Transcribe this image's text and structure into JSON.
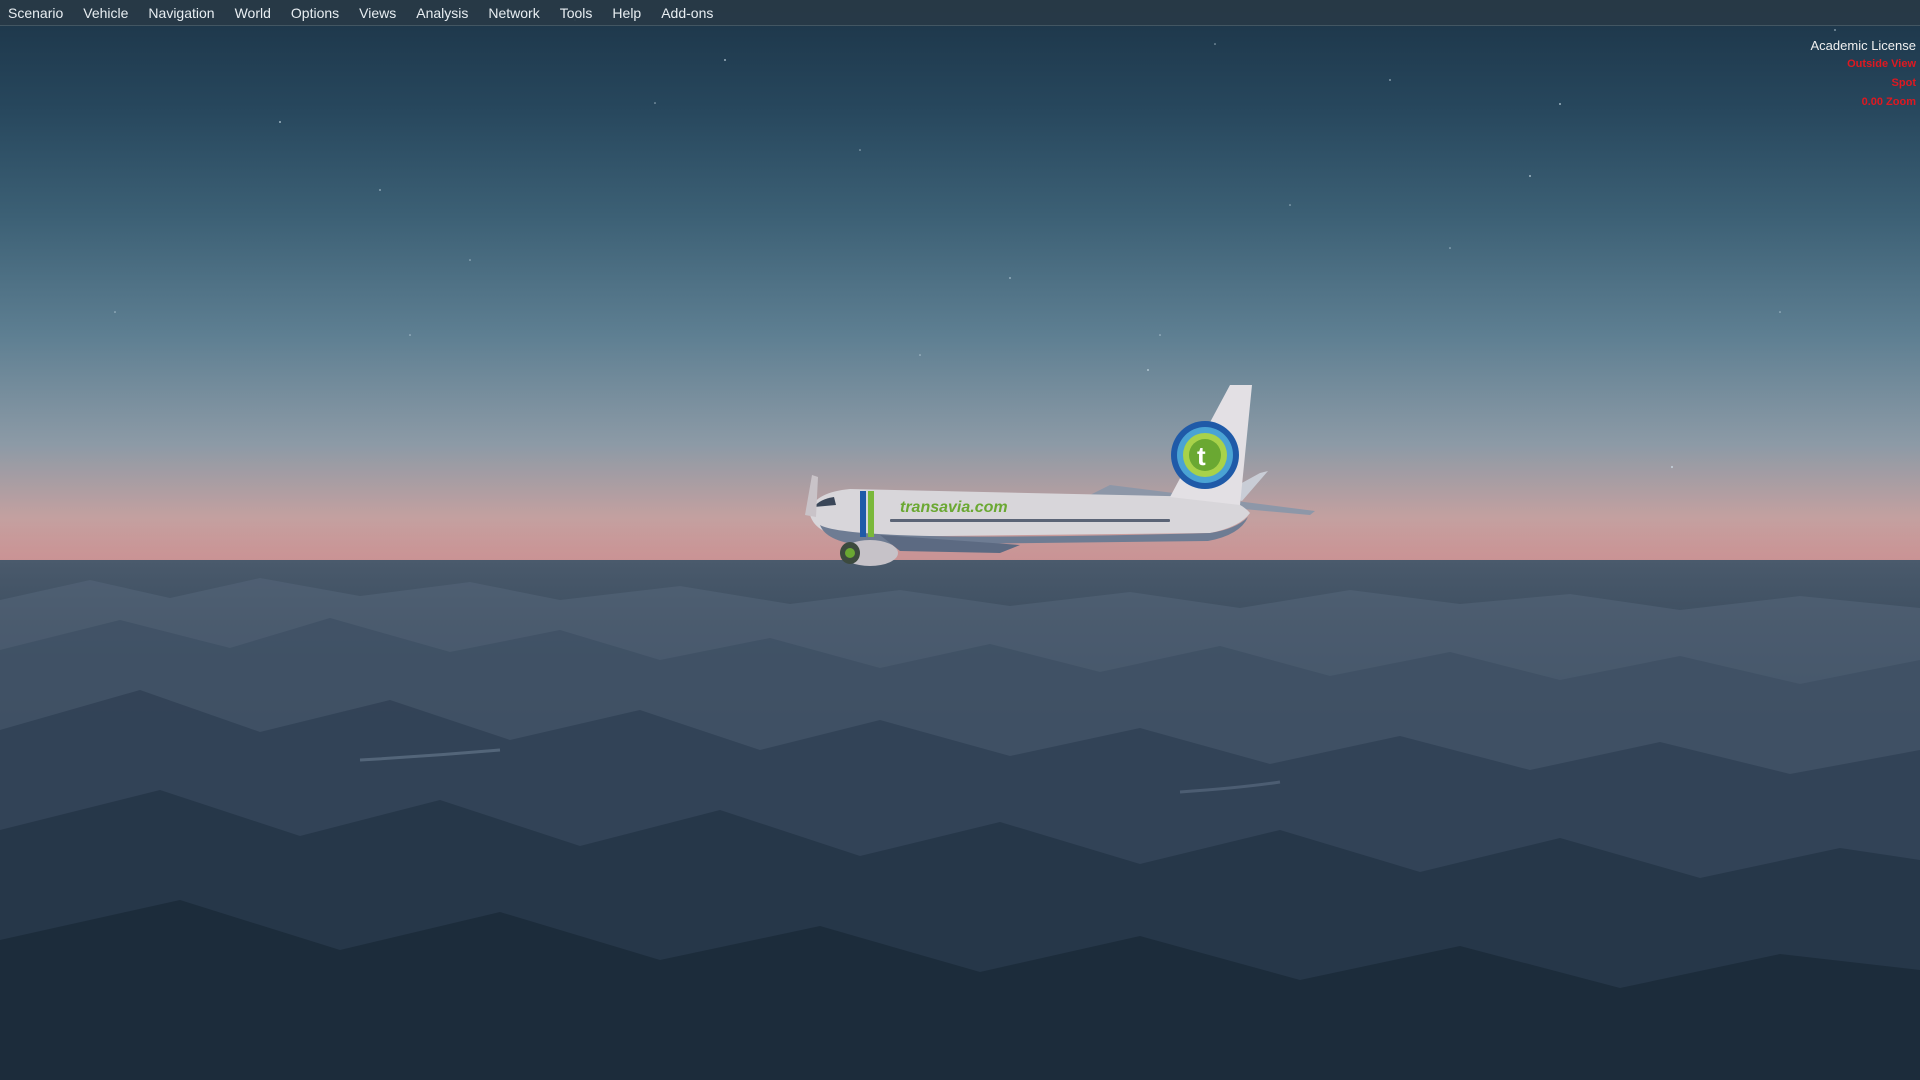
{
  "menu": {
    "items": [
      {
        "label": "Scenario"
      },
      {
        "label": "Vehicle"
      },
      {
        "label": "Navigation"
      },
      {
        "label": "World"
      },
      {
        "label": "Options"
      },
      {
        "label": "Views"
      },
      {
        "label": "Analysis"
      },
      {
        "label": "Network"
      },
      {
        "label": "Tools"
      },
      {
        "label": "Help"
      },
      {
        "label": "Add-ons"
      }
    ]
  },
  "overlay": {
    "license": "Academic License",
    "lines": [
      "Outside View",
      "Spot",
      "0.00 Zoom"
    ],
    "warning_color": "#e01820"
  },
  "scene": {
    "livery_text": "transavia.com",
    "tail_letter": "t"
  },
  "colors": {
    "menubar_bg": "#283a46",
    "livery_green": "#7ab83a",
    "livery_blue": "#1f5aa8"
  }
}
